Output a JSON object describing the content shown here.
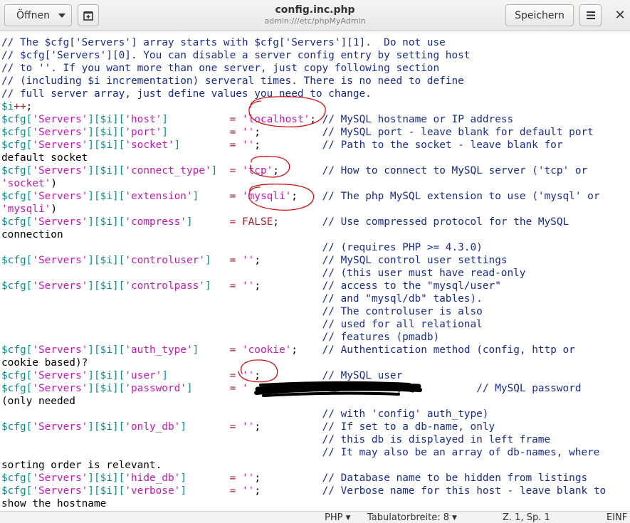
{
  "window": {
    "title": "config.inc.php",
    "path": "admin:///etc/phpMyAdmin"
  },
  "toolbar": {
    "open_label": "Öffnen",
    "open_menu_icon": "chevron-down-icon",
    "new_tab_icon": "new-document-icon",
    "save_label": "Speichern",
    "menu_icon": "hamburger-menu-icon",
    "close_icon": "close-icon"
  },
  "colors": {
    "comment": "#1a2c8c",
    "variable": "#0c8a8a",
    "string": "#c41ab2",
    "operator": "#a51d2d",
    "annotation_red": "#d01010",
    "redaction": "#000000"
  },
  "code_lines": [
    "// The $cfg['Servers'] array starts with $cfg['Servers'][1].  Do not use",
    "// $cfg['Servers'][0]. You can disable a server config entry by setting host",
    "// to ''. If you want more than one server, just copy following section",
    "// (including $i incrementation) serveral times. There is no need to define",
    "// full server array, just define values you need to change.",
    "$i++;",
    "$cfg['Servers'][$i]['host']          = 'localhost'; // MySQL hostname or IP address",
    "$cfg['Servers'][$i]['port']          = '';          // MySQL port - leave blank for default port",
    "$cfg['Servers'][$i]['socket']        = '';          // Path to the socket - leave blank for",
    "default socket",
    "$cfg['Servers'][$i]['connect_type']  = 'tcp';       // How to connect to MySQL server ('tcp' or",
    "'socket')",
    "$cfg['Servers'][$i]['extension']     = 'mysqli';    // The php MySQL extension to use ('mysql' or",
    "'mysqli')",
    "$cfg['Servers'][$i]['compress']      = FALSE;       // Use compressed protocol for the MySQL",
    "connection",
    "                                                    // (requires PHP >= 4.3.0)",
    "$cfg['Servers'][$i]['controluser']   = '';          // MySQL control user settings",
    "                                                    // (this user must have read-only",
    "$cfg['Servers'][$i]['controlpass']   = '';          // access to the \"mysql/user\"",
    "                                                    // and \"mysql/db\" tables).",
    "                                                    // The controluser is also",
    "                                                    // used for all relational",
    "                                                    // features (pmadb)",
    "$cfg['Servers'][$i]['auth_type']     = 'cookie';    // Authentication method (config, http or",
    "cookie based)?",
    "$cfg['Servers'][$i]['user']          = '';          // MySQL user",
    "$cfg['Servers'][$i]['password']      = '                       ';            // MySQL password",
    "(only needed",
    "                                                    // with 'config' auth_type)",
    "$cfg['Servers'][$i]['only_db']       = '';          // If set to a db-name, only",
    "                                                    // this db is displayed in left frame",
    "                                                    // It may also be an array of db-names, where",
    "sorting order is relevant.",
    "$cfg['Servers'][$i]['hide_db']       = '';          // Database name to be hidden from listings",
    "$cfg['Servers'][$i]['verbose']       = '';          // Verbose name for this host - leave blank to",
    "show the hostname"
  ],
  "status": {
    "language": "PHP",
    "tab_width": "Tabulatorbreite: 8",
    "position": "Z. 1, Sp. 1",
    "mode": "EINF"
  }
}
